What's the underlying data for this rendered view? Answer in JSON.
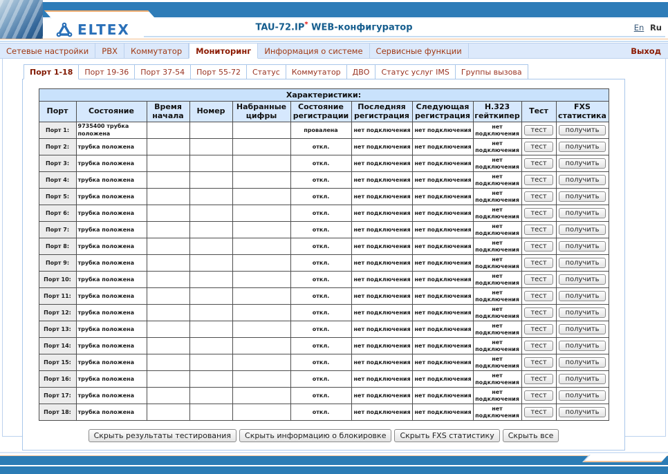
{
  "header": {
    "logo_text": "ELTEX",
    "title_main": "TAU-72.IP",
    "title_asterisk": "*",
    "title_suffix": " WEB-конфигуратор",
    "lang_en": "En",
    "lang_ru": "Ru"
  },
  "nav": {
    "items": [
      {
        "label": "Сетевые настройки",
        "active": false
      },
      {
        "label": "PBX",
        "active": false
      },
      {
        "label": "Коммутатор",
        "active": false
      },
      {
        "label": "Мониторинг",
        "active": true
      },
      {
        "label": "Информация о системе",
        "active": false
      },
      {
        "label": "Сервисные функции",
        "active": false
      }
    ],
    "logout_label": "Выход"
  },
  "subtabs": [
    {
      "label": "Порт 1-18",
      "active": true
    },
    {
      "label": "Порт 19-36",
      "active": false
    },
    {
      "label": "Порт 37-54",
      "active": false
    },
    {
      "label": "Порт 55-72",
      "active": false
    },
    {
      "label": "Статус",
      "active": false
    },
    {
      "label": "Коммутатор",
      "active": false
    },
    {
      "label": "ДВО",
      "active": false
    },
    {
      "label": "Статус услуг IMS",
      "active": false
    },
    {
      "label": "Группы вызова",
      "active": false
    }
  ],
  "table": {
    "caption": "Характеристики:",
    "columns": [
      "Порт",
      "Состояние",
      "Время начала",
      "Номер",
      "Набранные цифры",
      "Состояние регистрации",
      "Последняя регистрация",
      "Следующая регистрация",
      "Н.323 гейткипер",
      "Тест",
      "FXS статистика"
    ],
    "test_label": "тест",
    "fxs_label": "получить",
    "rows": [
      {
        "port": "Порт 1:",
        "state": "9735400 трубка положена",
        "time": "",
        "number": "",
        "digits": "",
        "reg_state": "провалена",
        "last_reg": "нет подключения",
        "next_reg": "нет подключения",
        "h323": "нет подключения"
      },
      {
        "port": "Порт 2:",
        "state": "трубка положена",
        "time": "",
        "number": "",
        "digits": "",
        "reg_state": "откл.",
        "last_reg": "нет подключения",
        "next_reg": "нет подключения",
        "h323": "нет подключения"
      },
      {
        "port": "Порт 3:",
        "state": "трубка положена",
        "time": "",
        "number": "",
        "digits": "",
        "reg_state": "откл.",
        "last_reg": "нет подключения",
        "next_reg": "нет подключения",
        "h323": "нет подключения"
      },
      {
        "port": "Порт 4:",
        "state": "трубка положена",
        "time": "",
        "number": "",
        "digits": "",
        "reg_state": "откл.",
        "last_reg": "нет подключения",
        "next_reg": "нет подключения",
        "h323": "нет подключения"
      },
      {
        "port": "Порт 5:",
        "state": "трубка положена",
        "time": "",
        "number": "",
        "digits": "",
        "reg_state": "откл.",
        "last_reg": "нет подключения",
        "next_reg": "нет подключения",
        "h323": "нет подключения"
      },
      {
        "port": "Порт 6:",
        "state": "трубка положена",
        "time": "",
        "number": "",
        "digits": "",
        "reg_state": "откл.",
        "last_reg": "нет подключения",
        "next_reg": "нет подключения",
        "h323": "нет подключения"
      },
      {
        "port": "Порт 7:",
        "state": "трубка положена",
        "time": "",
        "number": "",
        "digits": "",
        "reg_state": "откл.",
        "last_reg": "нет подключения",
        "next_reg": "нет подключения",
        "h323": "нет подключения"
      },
      {
        "port": "Порт 8:",
        "state": "трубка положена",
        "time": "",
        "number": "",
        "digits": "",
        "reg_state": "откл.",
        "last_reg": "нет подключения",
        "next_reg": "нет подключения",
        "h323": "нет подключения"
      },
      {
        "port": "Порт 9:",
        "state": "трубка положена",
        "time": "",
        "number": "",
        "digits": "",
        "reg_state": "откл.",
        "last_reg": "нет подключения",
        "next_reg": "нет подключения",
        "h323": "нет подключения"
      },
      {
        "port": "Порт 10:",
        "state": "трубка положена",
        "time": "",
        "number": "",
        "digits": "",
        "reg_state": "откл.",
        "last_reg": "нет подключения",
        "next_reg": "нет подключения",
        "h323": "нет подключения"
      },
      {
        "port": "Порт 11:",
        "state": "трубка положена",
        "time": "",
        "number": "",
        "digits": "",
        "reg_state": "откл.",
        "last_reg": "нет подключения",
        "next_reg": "нет подключения",
        "h323": "нет подключения"
      },
      {
        "port": "Порт 12:",
        "state": "трубка положена",
        "time": "",
        "number": "",
        "digits": "",
        "reg_state": "откл.",
        "last_reg": "нет подключения",
        "next_reg": "нет подключения",
        "h323": "нет подключения"
      },
      {
        "port": "Порт 13:",
        "state": "трубка положена",
        "time": "",
        "number": "",
        "digits": "",
        "reg_state": "откл.",
        "last_reg": "нет подключения",
        "next_reg": "нет подключения",
        "h323": "нет подключения"
      },
      {
        "port": "Порт 14:",
        "state": "трубка положена",
        "time": "",
        "number": "",
        "digits": "",
        "reg_state": "откл.",
        "last_reg": "нет подключения",
        "next_reg": "нет подключения",
        "h323": "нет подключения"
      },
      {
        "port": "Порт 15:",
        "state": "трубка положена",
        "time": "",
        "number": "",
        "digits": "",
        "reg_state": "откл.",
        "last_reg": "нет подключения",
        "next_reg": "нет подключения",
        "h323": "нет подключения"
      },
      {
        "port": "Порт 16:",
        "state": "трубка положена",
        "time": "",
        "number": "",
        "digits": "",
        "reg_state": "откл.",
        "last_reg": "нет подключения",
        "next_reg": "нет подключения",
        "h323": "нет подключения"
      },
      {
        "port": "Порт 17:",
        "state": "трубка положена",
        "time": "",
        "number": "",
        "digits": "",
        "reg_state": "откл.",
        "last_reg": "нет подключения",
        "next_reg": "нет подключения",
        "h323": "нет подключения"
      },
      {
        "port": "Порт 18:",
        "state": "трубка положена",
        "time": "",
        "number": "",
        "digits": "",
        "reg_state": "откл.",
        "last_reg": "нет подключения",
        "next_reg": "нет подключения",
        "h323": "нет подключения"
      }
    ]
  },
  "actions": [
    "Скрыть результаты тестирования",
    "Скрыть информацию о блокировке",
    "Скрыть FXS статистику",
    "Скрыть все"
  ]
}
